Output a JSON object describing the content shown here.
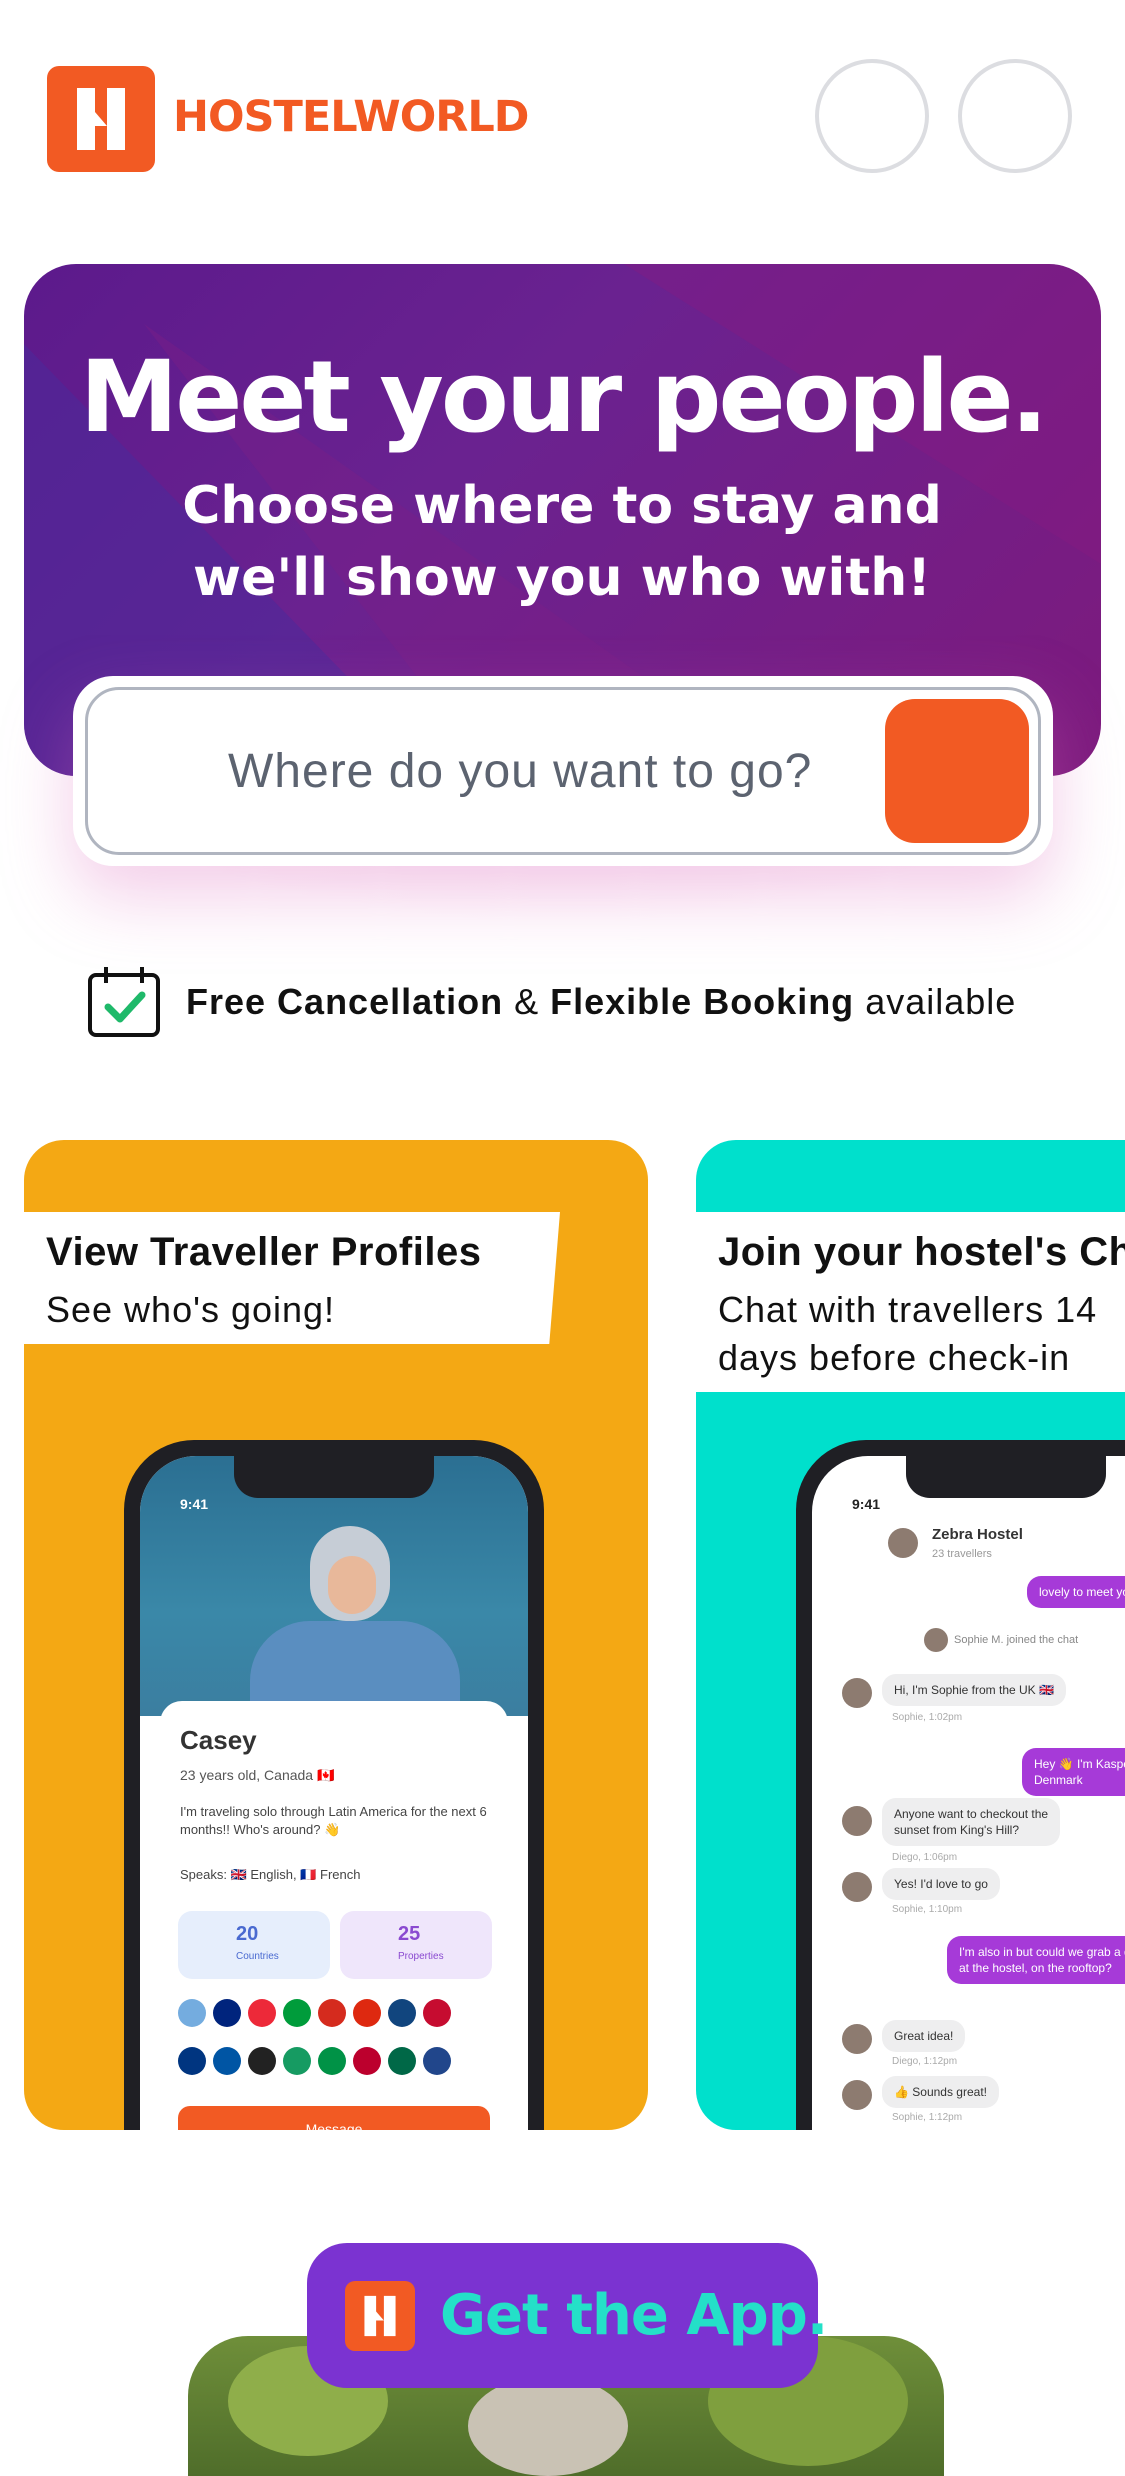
{
  "header": {
    "logo_text": "HOSTELWORLD",
    "brand_color": "#f25a23"
  },
  "hero": {
    "title": "Meet your people.",
    "subtitle": "Choose where to stay and we'll show you who with!",
    "background": "#6a2290"
  },
  "search": {
    "placeholder": "Where do you want to go?",
    "button_color": "#f25a23"
  },
  "cancellation": {
    "bold1": "Free Cancellation",
    "amp": "&",
    "bold2": "Flexible Booking",
    "tail": "available",
    "icon": "calendar-check-icon"
  },
  "cards": [
    {
      "title": "View Traveller Profiles",
      "subtitle": "See who's going!",
      "color": "#f4a814",
      "phone": {
        "time": "9:41",
        "name": "Casey",
        "meta": "23 years old, Canada 🇨🇦",
        "bio": "I'm traveling solo through Latin America for the next 6 months!! Who's around? 👋",
        "speaks": "Speaks: 🇬🇧 English, 🇫🇷 French",
        "stats": [
          {
            "value": "20",
            "label": "Countries"
          },
          {
            "value": "25",
            "label": "Properties"
          }
        ],
        "button": "Message"
      }
    },
    {
      "title": "Join your hostel's Chat",
      "subtitle": "Chat with travellers 14 days before check-in",
      "color": "#00e0cc",
      "phone": {
        "time": "9:41",
        "hostel": "Zebra Hostel",
        "travellers": "23 travellers",
        "messages": [
          {
            "text": "lovely to meet you!",
            "dir": "out"
          },
          {
            "text": "Sophie M. joined the chat",
            "dir": "system"
          },
          {
            "text": "Hi, I'm Sophie from the UK 🇬🇧",
            "meta": "Sophie, 1:02pm",
            "dir": "in"
          },
          {
            "text": "Hey 👋 I'm Kasper from Denmark",
            "dir": "out"
          },
          {
            "text": "Anyone want to checkout the\nsunset from King's Hill?",
            "meta": "Diego, 1:06pm",
            "dir": "in"
          },
          {
            "text": "Yes! I'd love to go",
            "meta": "Sophie, 1:10pm",
            "dir": "in"
          },
          {
            "text": "I'm also in but could we grab a drink\nat the hostel, on the rooftop?",
            "dir": "out"
          },
          {
            "text": "Great idea!",
            "meta": "Diego, 1:12pm",
            "dir": "in"
          },
          {
            "text": "👍 Sounds great!",
            "meta": "Sophie, 1:12pm",
            "dir": "in"
          }
        ]
      }
    }
  ],
  "cta": {
    "label": "Get the App.",
    "background": "#7b33d1",
    "text_color": "#24e0c8"
  }
}
